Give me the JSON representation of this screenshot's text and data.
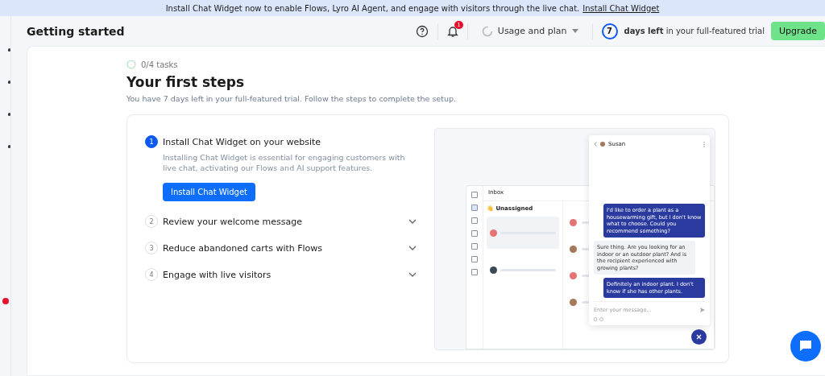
{
  "banner": {
    "text": "Install Chat Widget now to enable Flows, Lyro AI Agent, and engage with visitors through the live chat.",
    "link": "Install Chat Widget"
  },
  "header": {
    "title": "Getting started",
    "notification_count": "1",
    "usage_menu": "Usage and plan",
    "trial_days": "7",
    "trial_text": "**days left** in your full-featured trial",
    "upgrade_button": "Upgrade"
  },
  "progress": {
    "label": "0/4 tasks",
    "level": 0
  },
  "heading": "Your first steps",
  "subtitle": "You have 7 days left in your full-featured trial. Follow the steps to complete the setup.",
  "steps": [
    {
      "number": "1",
      "title": "Install Chat Widget on your website",
      "expanded": true,
      "description": "Installing Chat Widget is essential for engaging customers with live chat, activating our Flows and AI support features.",
      "button": "Install Chat Widget"
    },
    {
      "number": "2",
      "title": "Review your welcome message",
      "expanded": false
    },
    {
      "number": "3",
      "title": "Reduce abandoned carts with Flows",
      "expanded": false
    },
    {
      "number": "4",
      "title": "Engage with live visitors",
      "expanded": false
    }
  ],
  "preview": {
    "inbox_title": "Inbox",
    "folder": "👋 Unassigned",
    "contact": "Susan",
    "input_placeholder": "Enter your message...",
    "messages": [
      {
        "kind": "visitor",
        "text": "I'd like to order a plant as a housewarming gift, but I don't know what to choose. Could you recommend something?"
      },
      {
        "kind": "agent",
        "text": "Sure thing. Are you looking for an indoor or an outdoor plant?  And is the recipient experienced with growing plants?"
      },
      {
        "kind": "visitor",
        "text": "Definitely an indoor plant. I don't know if she has other plants."
      }
    ]
  }
}
